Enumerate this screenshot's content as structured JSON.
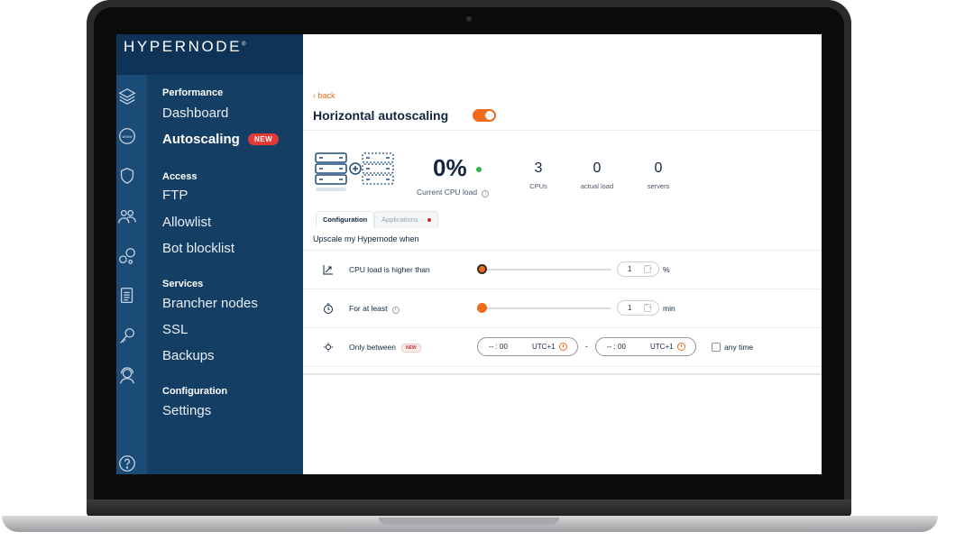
{
  "brand": {
    "logo_text": "HYPERNODE",
    "logo_mark": "®"
  },
  "sidebar": {
    "sections": [
      {
        "title": "Performance",
        "items": [
          "Dashboard",
          "Autoscaling"
        ]
      },
      {
        "title": "Access",
        "items": [
          "FTP",
          "Allowlist",
          "Bot blocklist"
        ]
      },
      {
        "title": "Services",
        "items": [
          "Brancher nodes",
          "SSL",
          "Backups"
        ]
      },
      {
        "title": "Configuration",
        "items": [
          "Settings"
        ]
      }
    ],
    "active_item": "Autoscaling",
    "new_badge": "NEW"
  },
  "main": {
    "back_label": "‹ back",
    "title": "Horizontal autoscaling",
    "toggle_on": true,
    "cpu_load": {
      "value": "0%",
      "label": "Current CPU load"
    },
    "stats": [
      {
        "value": "3",
        "label": "CPUs"
      },
      {
        "value": "0",
        "label": "actual load"
      },
      {
        "value": "0",
        "label": "servers"
      }
    ],
    "tabs": [
      {
        "label": "Configuration",
        "active": true
      },
      {
        "label": "Applications",
        "active": false
      }
    ],
    "section_heading": "Upscale my Hypernode when",
    "rows": {
      "cpu": {
        "label": "CPU load is higher than",
        "value": "1",
        "unit": "%"
      },
      "duration": {
        "label": "For at least",
        "value": "1",
        "unit": "min"
      },
      "window": {
        "label": "Only between",
        "badge": "NEW",
        "from": {
          "time": "-- : 00",
          "tz": "UTC+1"
        },
        "to": {
          "time": "-- : 00",
          "tz": "UTC+1"
        },
        "separator": "-",
        "any_time_label": "any time"
      }
    }
  },
  "colors": {
    "accent": "#ef6c1a",
    "sidebar": "#143e64",
    "status_green": "#2fb34d",
    "badge_red": "#e53935"
  }
}
